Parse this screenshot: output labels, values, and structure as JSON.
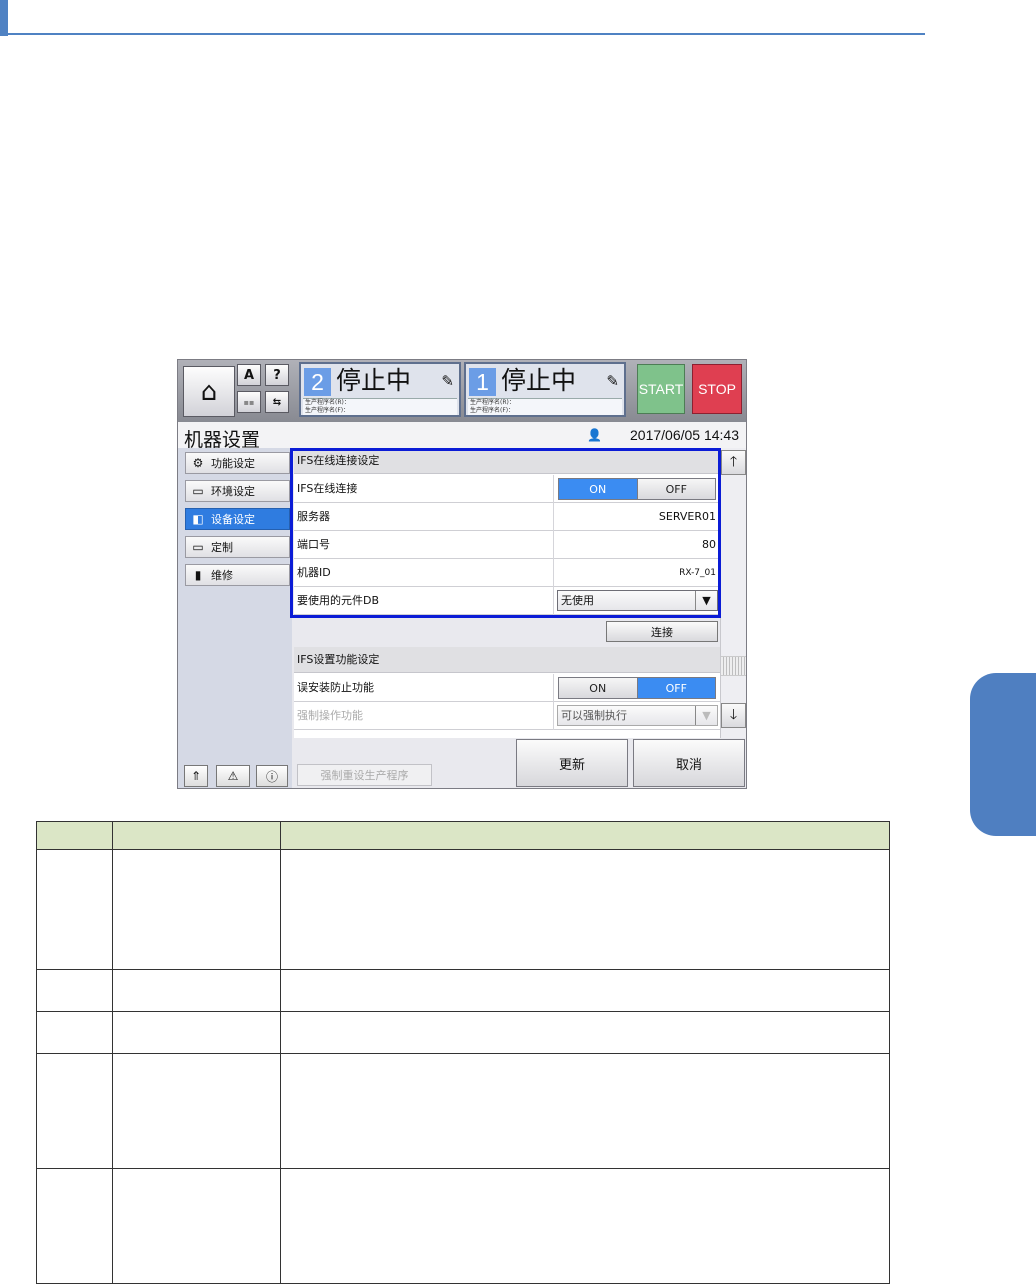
{
  "hmi": {
    "header": {
      "status_1": {
        "number": "2",
        "state": "停止中",
        "prog_r": "生产程序名(R)：",
        "prog_f": "生产程序名(F)："
      },
      "status_2": {
        "number": "1",
        "state": "停止中",
        "prog_r": "生产程序名(R)：",
        "prog_f": "生产程序名(F)："
      },
      "btn_a": "A",
      "btn_help": "?",
      "start_label": "START",
      "stop_label": "STOP"
    },
    "title": "机器设置",
    "datetime": "2017/06/05 14:43",
    "nav": [
      {
        "label": "功能设定"
      },
      {
        "label": "环境设定"
      },
      {
        "label": "设备设定"
      },
      {
        "label": "定制"
      },
      {
        "label": "维修"
      }
    ],
    "section1": {
      "title": "IFS在线连接设定",
      "rows": {
        "online": {
          "label": "IFS在线连接",
          "on": "ON",
          "off": "OFF",
          "state": "ON"
        },
        "server": {
          "label": "服务器",
          "value": "SERVER01"
        },
        "port": {
          "label": "端口号",
          "value": "80"
        },
        "machine_id": {
          "label": "机器ID",
          "value": "RX-7_01"
        },
        "component_db": {
          "label": "要使用的元件DB",
          "value": "无使用"
        }
      },
      "connect_label": "连接"
    },
    "section2": {
      "title": "IFS设置功能设定",
      "rows": {
        "misinstall": {
          "label": "误安装防止功能",
          "on": "ON",
          "off": "OFF",
          "state": "OFF"
        },
        "force_op": {
          "label": "强制操作功能",
          "value": "可以强制执行"
        }
      }
    },
    "footer": {
      "force_reset_label": "强制重设生产程序",
      "update_label": "更新",
      "cancel_label": "取消"
    }
  },
  "colors": {
    "accent_blue": "#4f82c3",
    "highlight": "#0b1cd6",
    "table_header": "#dbe6c6",
    "toggle_on": "#3b8cf2",
    "start_green": "#7fc28b",
    "stop_red": "#df3f51"
  }
}
